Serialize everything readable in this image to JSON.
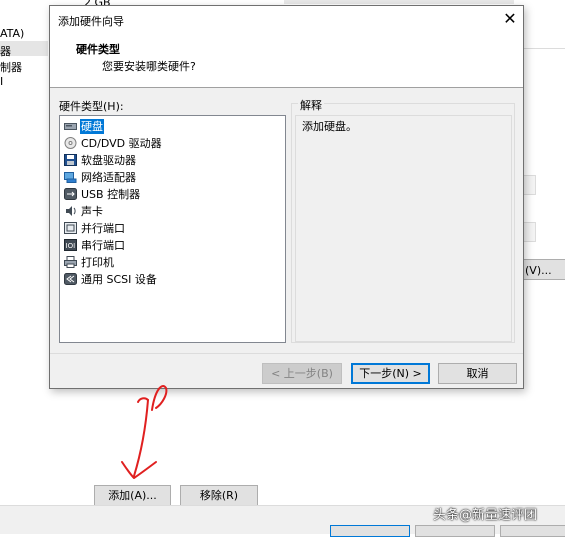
{
  "background": {
    "left_texts": [
      "2 GB",
      "ATA)",
      "器",
      "制器",
      "I"
    ],
    "right_button_label": "(V)...",
    "add_button": "添加(A)...",
    "remove_button": "移除(R)"
  },
  "dialog": {
    "title": "添加硬件向导",
    "close_glyph": "✕",
    "header_title": "硬件类型",
    "header_subtitle": "您要安装哪类硬件?",
    "list_label": "硬件类型(H):",
    "items": [
      {
        "label": "硬盘",
        "icon": "hard-disk-icon",
        "selected": true
      },
      {
        "label": "CD/DVD 驱动器",
        "icon": "cd-dvd-icon",
        "selected": false
      },
      {
        "label": "软盘驱动器",
        "icon": "floppy-icon",
        "selected": false
      },
      {
        "label": "网络适配器",
        "icon": "network-adapter-icon",
        "selected": false
      },
      {
        "label": "USB 控制器",
        "icon": "usb-icon",
        "selected": false
      },
      {
        "label": "声卡",
        "icon": "sound-card-icon",
        "selected": false
      },
      {
        "label": "并行端口",
        "icon": "parallel-port-icon",
        "selected": false
      },
      {
        "label": "串行端口",
        "icon": "serial-port-icon",
        "selected": false
      },
      {
        "label": "打印机",
        "icon": "printer-icon",
        "selected": false
      },
      {
        "label": "通用 SCSI 设备",
        "icon": "scsi-device-icon",
        "selected": false
      }
    ],
    "explain_legend": "解释",
    "explain_text": "添加硬盘。",
    "buttons": {
      "back": "< 上一步(B)",
      "next": "下一步(N) >",
      "cancel": "取消"
    }
  },
  "watermark": "头条@新量速评团",
  "colors": {
    "selection": "#0078d7",
    "annotation": "#e02020",
    "dialog_bg": "#f0f0f0"
  }
}
